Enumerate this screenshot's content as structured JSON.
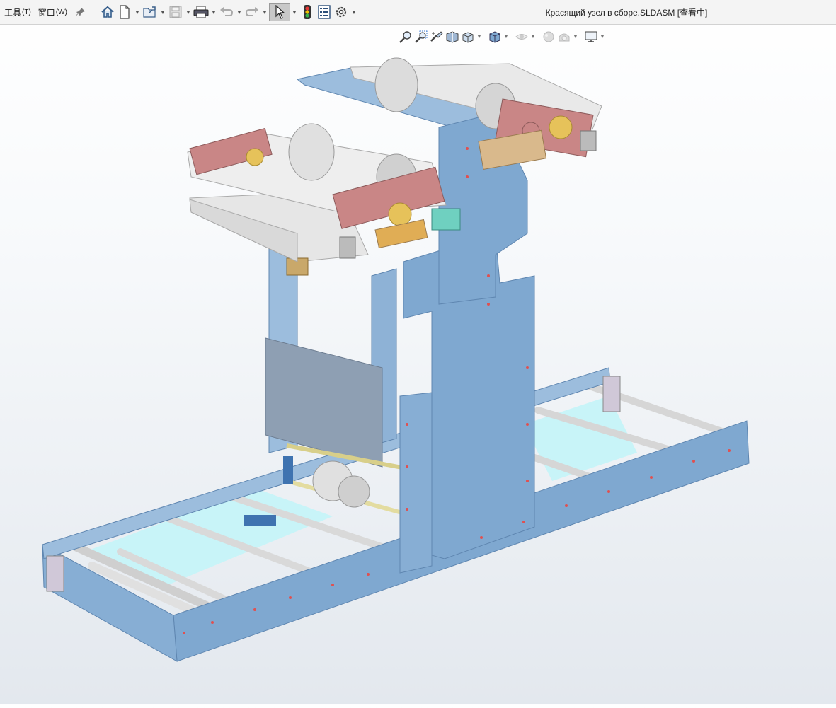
{
  "menu": [
    {
      "label": "工具",
      "accel": "(T)"
    },
    {
      "label": "窗口",
      "accel": "(W)"
    }
  ],
  "document": {
    "title": "Красящий узел в сборе.SLDASM [查看中]"
  },
  "toolbar": {
    "icons": [
      "home-icon",
      "new-document-icon",
      "open-folder-icon",
      "save-icon",
      "print-icon",
      "undo-icon",
      "redo-icon",
      "select-arrow-icon",
      "traffic-light-icon",
      "file-properties-icon",
      "options-gear-icon"
    ]
  },
  "view_toolbar": {
    "icons": [
      "zoom-to-fit-icon",
      "zoom-to-area-icon",
      "previous-view-icon",
      "section-view-icon",
      "view-orientation-icon",
      "display-style-icon",
      "hide-show-items-icon",
      "edit-appearance-icon",
      "apply-scene-icon",
      "view-settings-icon"
    ]
  },
  "colors": {
    "frame": "#7fa8d0",
    "frame_dark": "#5f86b0",
    "panel": "#8e9fb3",
    "floor": "#c8f4f8",
    "roller": "#e8e8e8",
    "bracket_red": "#c98686",
    "gear_yellow": "#e6c25a"
  }
}
